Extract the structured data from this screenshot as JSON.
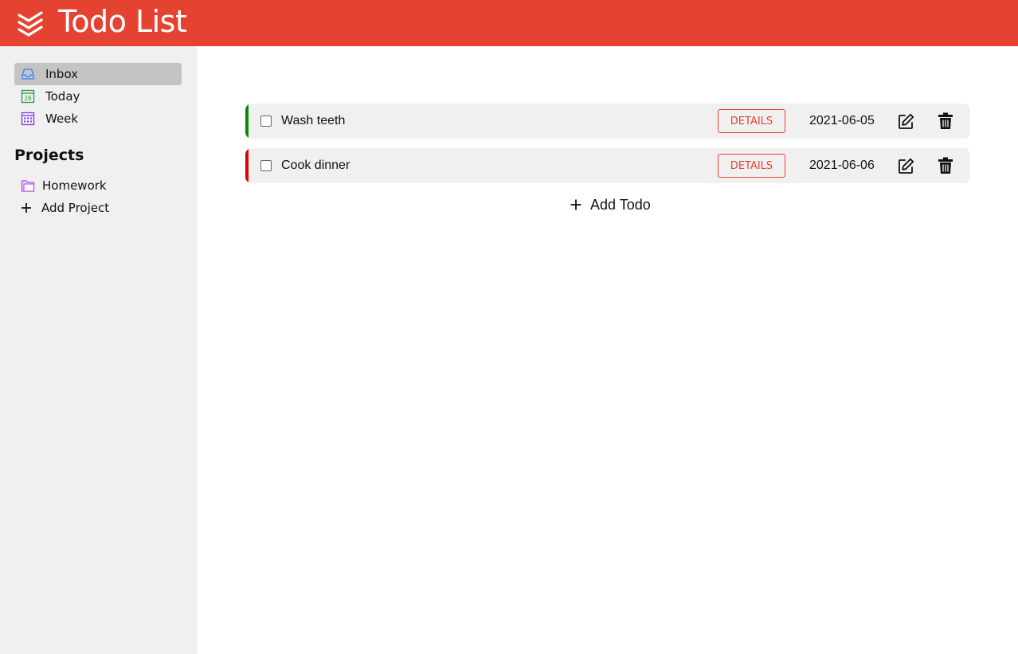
{
  "header": {
    "title": "Todo List",
    "logo_icon": "stacked-chevrons-icon",
    "background": "#e44332"
  },
  "sidebar": {
    "items": [
      {
        "label": "Inbox",
        "icon": "inbox-tray-icon",
        "icon_color": "#3b82f6",
        "active": true
      },
      {
        "label": "Today",
        "icon": "calendar-day-icon",
        "icon_color": "#1e9e3a",
        "day": "26"
      },
      {
        "label": "Week",
        "icon": "calendar-week-icon",
        "icon_color": "#7c3aed"
      }
    ],
    "projects_title": "Projects",
    "projects": [
      {
        "label": "Homework",
        "icon": "folder-icon",
        "icon_color": "#b44fe8"
      }
    ],
    "add_project_label": "Add Project"
  },
  "todos": [
    {
      "name": "Wash teeth",
      "details_label": "DETAILS",
      "date": "2021-06-05",
      "priority_color": "#0a8a0a",
      "checked": false
    },
    {
      "name": "Cook dinner",
      "details_label": "DETAILS",
      "date": "2021-06-06",
      "priority_color": "#e00000",
      "checked": false
    }
  ],
  "add_todo_label": "Add Todo"
}
